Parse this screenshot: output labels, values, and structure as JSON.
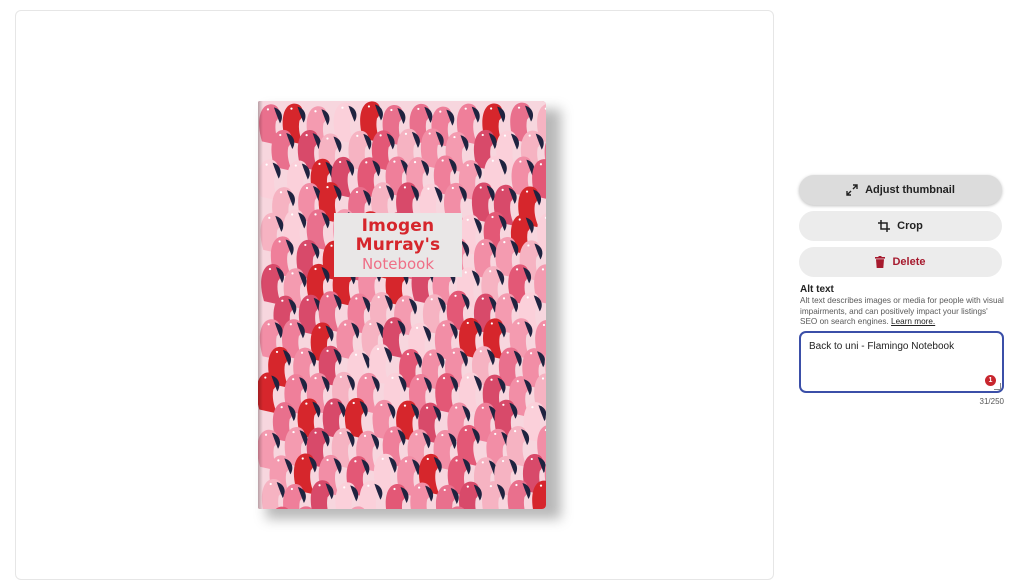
{
  "preview": {
    "image_alt": "Flamingo Notebook",
    "title_line1": "Imogen Murray's",
    "title_line2": "Notebook",
    "colors": {
      "cover_pink": "#f28ea6",
      "flamingo_red": "#d6262c",
      "beak_navy": "#1f2340",
      "label_bg": "#e9e7e7"
    }
  },
  "actions": {
    "adjust_label": "Adjust thumbnail",
    "crop_label": "Crop",
    "delete_label": "Delete"
  },
  "icons": {
    "adjust": "expand-arrows-icon",
    "crop": "crop-icon",
    "delete": "trash-icon"
  },
  "alt_text": {
    "heading": "Alt text",
    "description": "Alt text describes images or media for people with visual impairments, and can positively impact your listings' SEO on search engines.",
    "learn_more": "Learn more.",
    "value": "Back to uni - Flamingo Notebook",
    "error_count": "1",
    "char_count": "31/250"
  }
}
